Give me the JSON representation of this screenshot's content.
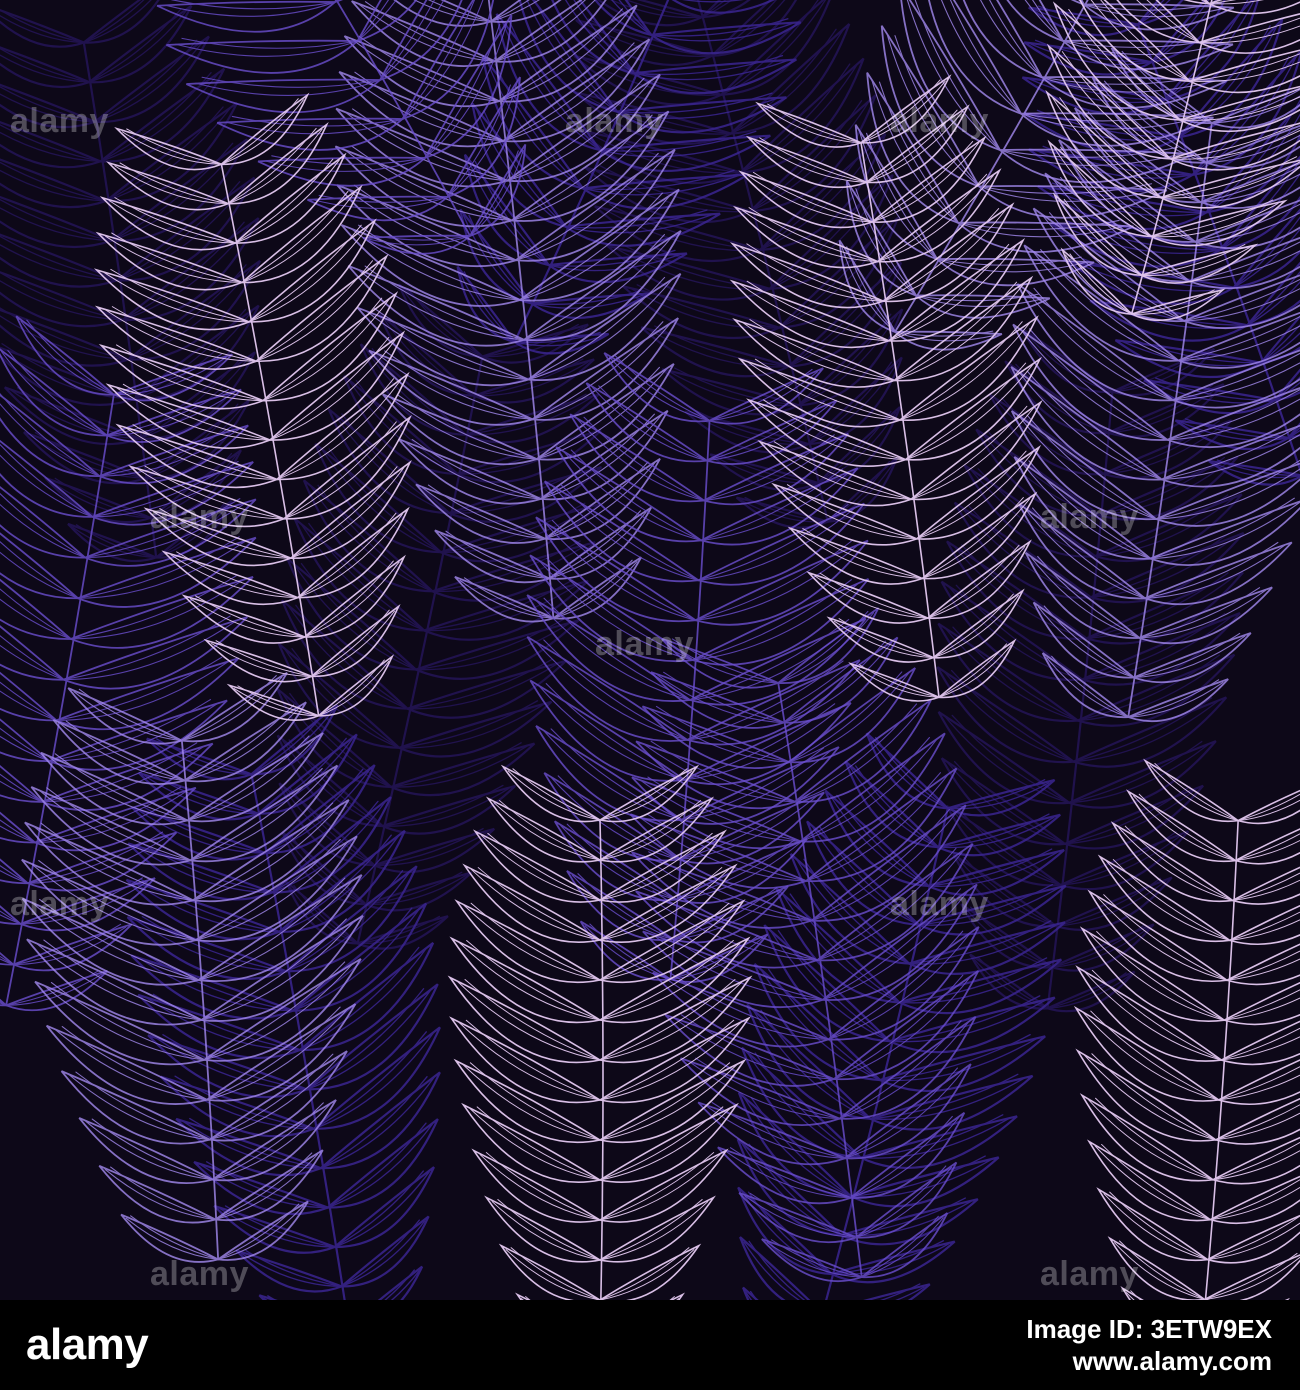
{
  "image": {
    "subject": "seamless fern leaf pattern",
    "palette": {
      "background": "#0d0818",
      "deep_violet": "#241457",
      "indigo": "#3a2590",
      "medium_purple": "#6b4fcf",
      "lavender": "#a48af0",
      "pale_lilac": "#e4c9f2"
    }
  },
  "watermark": {
    "text": "alamy"
  },
  "footer": {
    "logo": "alamy",
    "image_id_line1": "Image ID: 3ETW9EX",
    "image_id_line2": "www.alamy.com"
  }
}
